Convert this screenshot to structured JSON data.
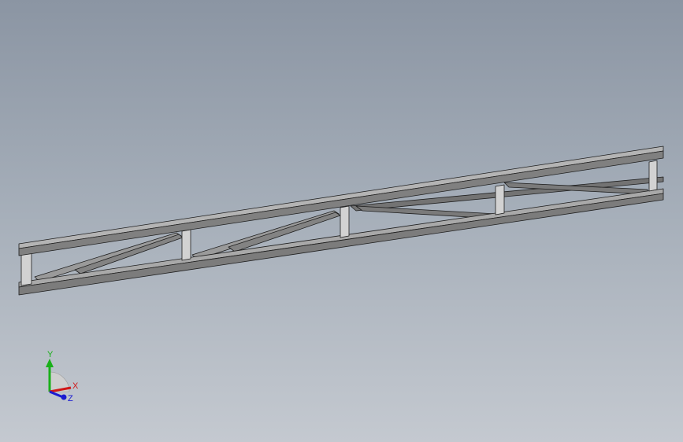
{
  "viewport": {
    "background_top": "#8b95a3",
    "background_bottom": "#c4c9d0"
  },
  "model": {
    "part": "truss-frame",
    "face_color": "#8e8e8e",
    "edge_color": "#1e1e1e"
  },
  "triad": {
    "x_label": "X",
    "y_label": "Y",
    "z_label": "Z",
    "x_color": "#d01818",
    "y_color": "#19b019",
    "z_color": "#1a1ad0"
  }
}
